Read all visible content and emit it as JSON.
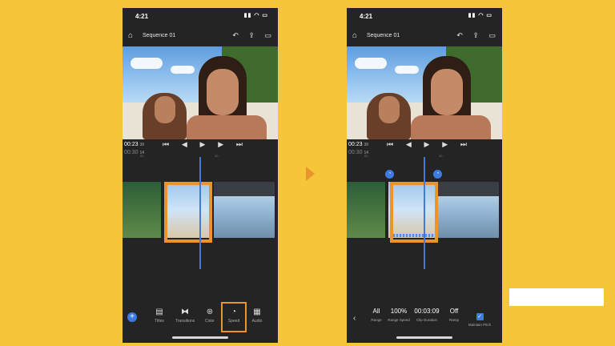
{
  "status": {
    "time": "4:21"
  },
  "header": {
    "title": "Sequence 01"
  },
  "timecode": {
    "current": "00:23",
    "current_frames": "38",
    "total": "00:30",
    "total_frames": "14"
  },
  "ruler": {
    "t1": "00",
    "t2": "00"
  },
  "toolbar_left": {
    "add": "+",
    "tools": [
      {
        "label": "Titles",
        "icon": "titles-icon"
      },
      {
        "label": "Transitions",
        "icon": "transitions-icon"
      },
      {
        "label": "Color",
        "icon": "color-icon"
      },
      {
        "label": "Speed",
        "icon": "speed-icon"
      },
      {
        "label": "Audio",
        "icon": "audio-icon"
      }
    ]
  },
  "speed_options": [
    {
      "value": "All",
      "label": "Range"
    },
    {
      "value": "100%",
      "label": "Range Speed"
    },
    {
      "value": "00:03:09",
      "label": "Clip Duration"
    },
    {
      "value": "Off",
      "label": "Ramp"
    },
    {
      "value": "",
      "label": "Maintain Pitch"
    }
  ],
  "colors": {
    "background": "#F7C53A",
    "accent": "#E8952E",
    "blue": "#3E7BE0"
  }
}
